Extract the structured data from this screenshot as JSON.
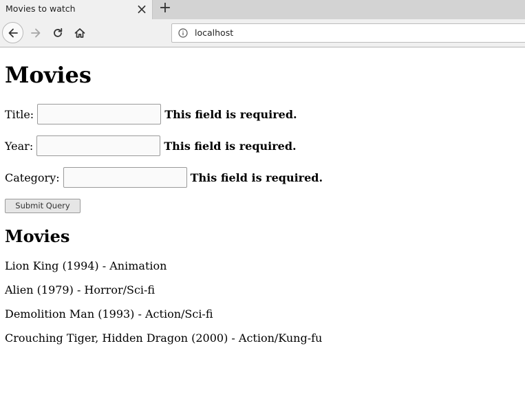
{
  "browser": {
    "tab_title": "Movies to watch",
    "tab_close_glyph": "×",
    "new_tab_glyph": "+",
    "url": "localhost"
  },
  "page": {
    "heading": "Movies",
    "form": {
      "fields": [
        {
          "label": "Title:",
          "value": "",
          "error": "This field is required."
        },
        {
          "label": "Year:",
          "value": "",
          "error": "This field is required."
        },
        {
          "label": "Category:",
          "value": "",
          "error": "This field is required."
        }
      ],
      "submit_label": "Submit Query"
    },
    "list_heading": "Movies",
    "movies": [
      "Lion King (1994) - Animation",
      "Alien (1979) - Horror/Sci-fi",
      "Demolition Man (1993) - Action/Sci-fi",
      "Crouching Tiger, Hidden Dragon (2000) - Action/Kung-fu"
    ]
  }
}
